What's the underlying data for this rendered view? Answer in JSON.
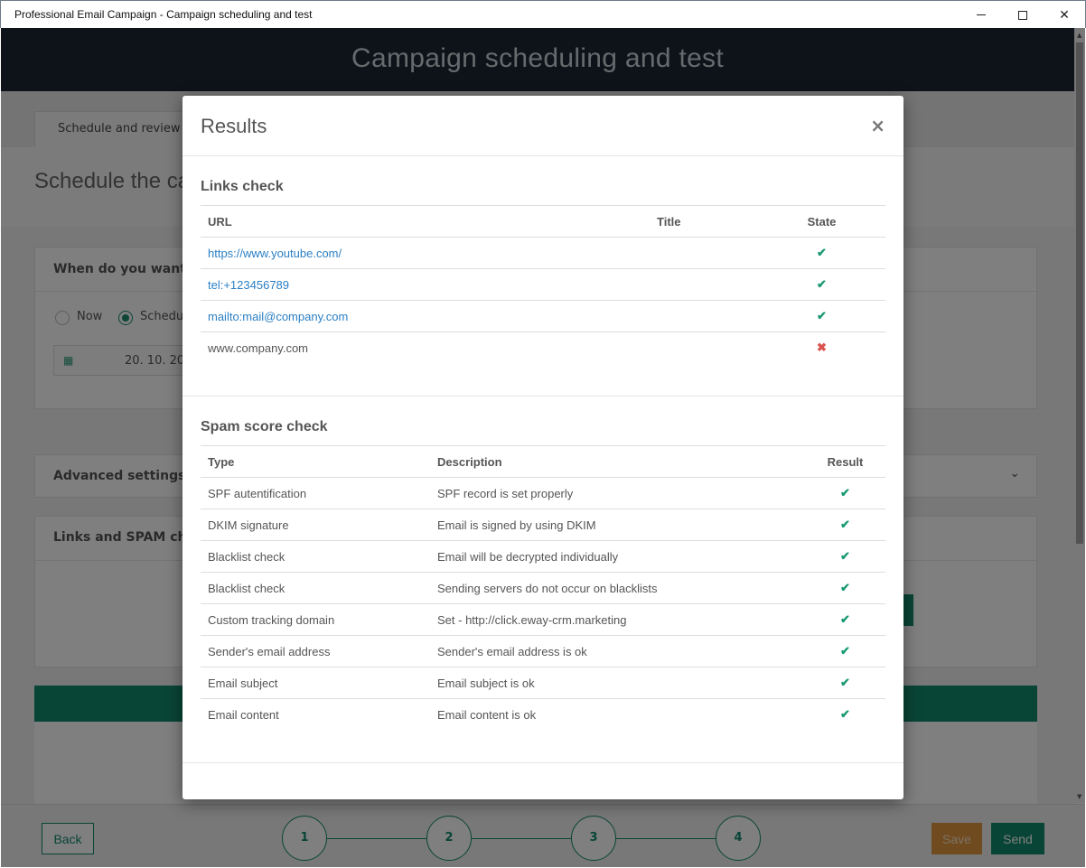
{
  "window": {
    "title": "Professional Email Campaign - Campaign scheduling and test",
    "minimize_glyph": "",
    "maximize_glyph": "",
    "close_glyph": "✕"
  },
  "app_header": {
    "title": "Campaign scheduling and test"
  },
  "background": {
    "tab_label": "Schedule and review",
    "page_title": "Schedule the ca",
    "when_card_title": "When do you want m",
    "radio_now": "Now",
    "radio_schedule": "Schedul",
    "date_value": "20. 10. 20",
    "advanced_settings": "Advanced settings",
    "links_spam_title": "Links and SPAM chec"
  },
  "footer": {
    "back_label": "Back",
    "steps": [
      "1",
      "2",
      "3",
      "4"
    ],
    "save_label": "Save",
    "send_label": "Send"
  },
  "modal": {
    "title": "Results",
    "close_glyph": "×",
    "links_check": {
      "title": "Links check",
      "headers": {
        "url": "URL",
        "title": "Title",
        "state": "State"
      },
      "rows": [
        {
          "url": "https://www.youtube.com/",
          "title": "",
          "state": "ok",
          "is_link": true
        },
        {
          "url": "tel:+123456789",
          "title": "",
          "state": "ok",
          "is_link": true
        },
        {
          "url": "mailto:mail@company.com",
          "title": "",
          "state": "ok",
          "is_link": true
        },
        {
          "url": "www.company.com",
          "title": "",
          "state": "fail",
          "is_link": false
        }
      ]
    },
    "spam_check": {
      "title": "Spam score check",
      "headers": {
        "type": "Type",
        "description": "Description",
        "result": "Result"
      },
      "rows": [
        {
          "type": "SPF autentification",
          "description": "SPF record is set properly",
          "result": "ok"
        },
        {
          "type": "DKIM signature",
          "description": "Email is signed by using DKIM",
          "result": "ok"
        },
        {
          "type": "Blacklist check",
          "description": "Email will be decrypted individually",
          "result": "ok"
        },
        {
          "type": "Blacklist check",
          "description": "Sending servers do not occur on blacklists",
          "result": "ok"
        },
        {
          "type": "Custom tracking domain",
          "description": "Set - http://click.eway-crm.marketing",
          "result": "ok"
        },
        {
          "type": "Sender's email address",
          "description": "Sender's email address is ok",
          "result": "ok"
        },
        {
          "type": "Email subject",
          "description": "Email subject is ok",
          "result": "ok"
        },
        {
          "type": "Email content",
          "description": "Email content is ok",
          "result": "ok"
        }
      ]
    }
  },
  "icons": {
    "ok": "check-icon",
    "fail": "cross-icon"
  },
  "colors": {
    "accent": "#128a6d",
    "header_bg": "#1c2633",
    "link": "#2b7fc4",
    "ok": "#1a9a72",
    "fail": "#d9534f",
    "save": "#e09640"
  }
}
